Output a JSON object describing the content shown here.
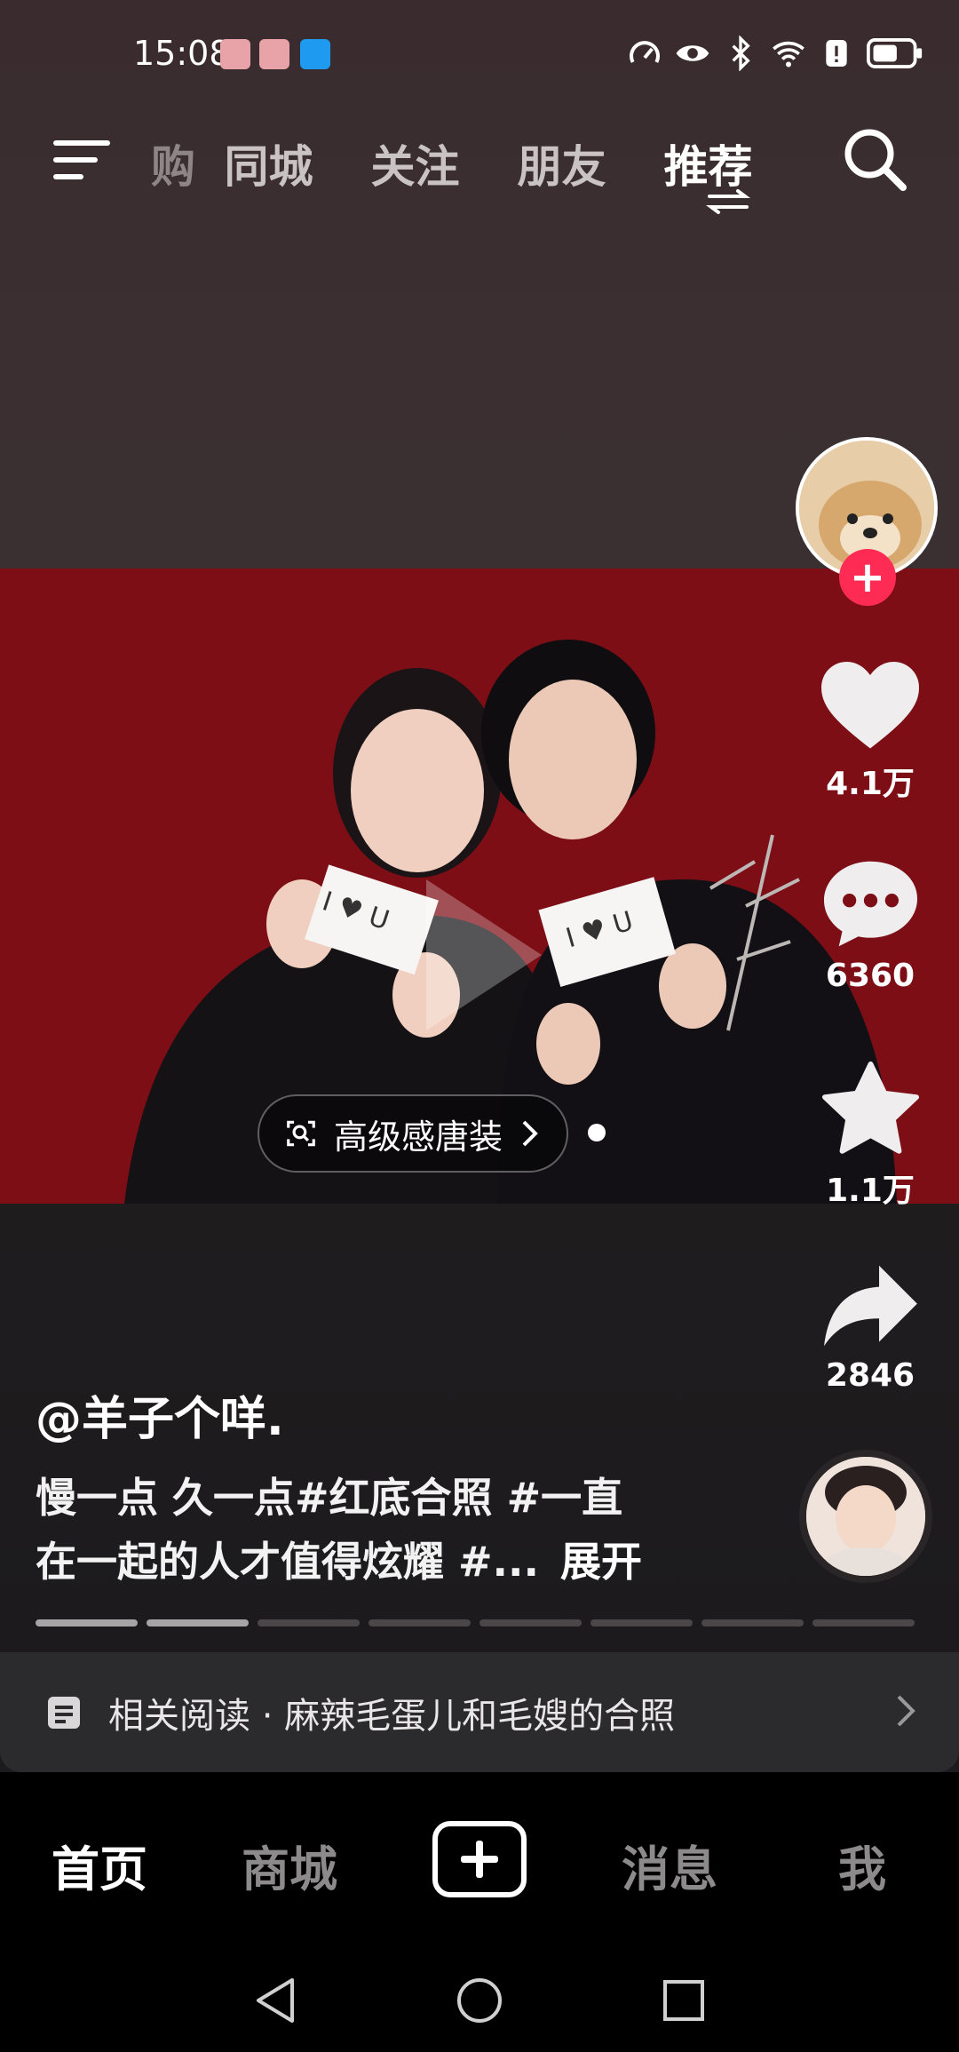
{
  "status_bar": {
    "time": "15:08"
  },
  "top_nav": {
    "tabs": [
      {
        "label": "购",
        "state": "partial"
      },
      {
        "label": "同城",
        "state": "normal"
      },
      {
        "label": "关注",
        "state": "normal"
      },
      {
        "label": "朋友",
        "state": "normal"
      },
      {
        "label": "推荐",
        "state": "active"
      }
    ]
  },
  "media": {
    "tag_label": "高级感唐装",
    "card_left": "I ♥ U",
    "card_right": "I ♥ U"
  },
  "actions": {
    "likes": "4.1万",
    "comments": "6360",
    "favorites": "1.1万",
    "shares": "2846"
  },
  "post": {
    "author": "@羊子个咩.",
    "caption_line1": "慢一点 久一点#红底合照 #一直",
    "caption_line2": "在一起的人才值得炫耀 #...",
    "expand_label": "展开",
    "progress": {
      "total_segments": 8,
      "completed_segments": 2
    }
  },
  "related": {
    "label": "相关阅读 · 麻辣毛蛋儿和毛嫂的合照"
  },
  "bottom_nav": {
    "items": [
      {
        "label": "首页",
        "state": "active"
      },
      {
        "label": "商城",
        "state": "normal"
      },
      {
        "label": "消息",
        "state": "normal"
      },
      {
        "label": "我",
        "state": "normal"
      }
    ]
  },
  "colors": {
    "accent": "#fe2c55",
    "media_bg": "#7a0d14"
  }
}
